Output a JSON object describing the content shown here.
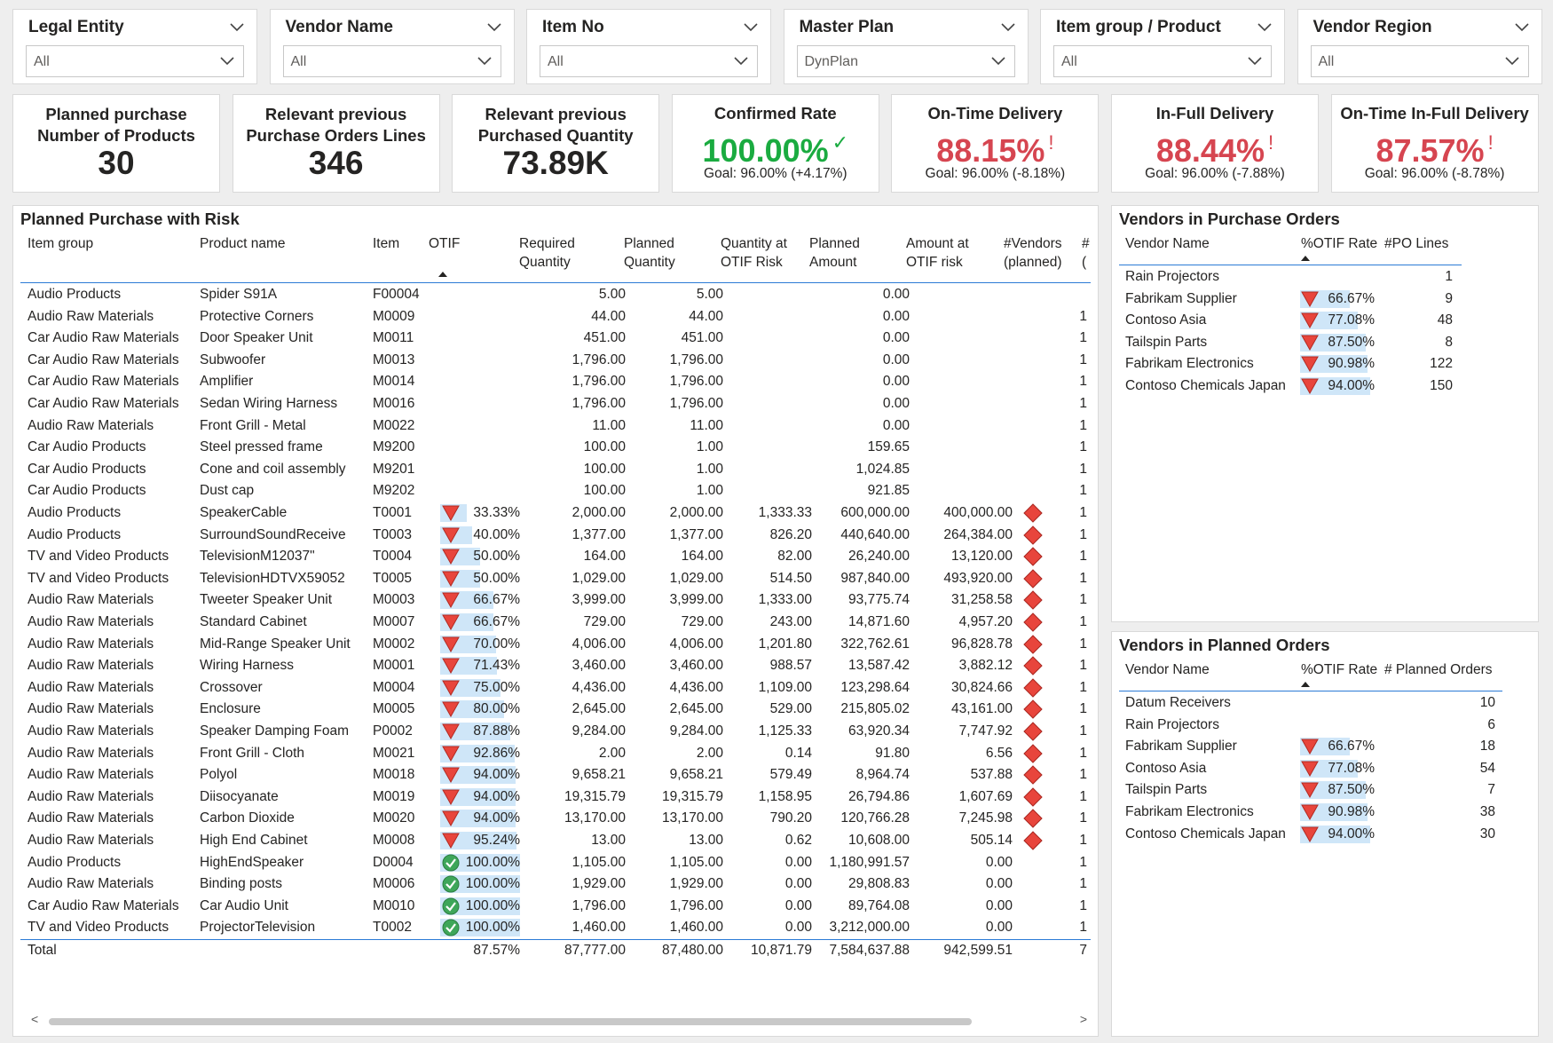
{
  "slicers": [
    {
      "title": "Legal Entity",
      "value": "All"
    },
    {
      "title": "Vendor Name",
      "value": "All"
    },
    {
      "title": "Item No",
      "value": "All"
    },
    {
      "title": "Master Plan",
      "value": "DynPlan"
    },
    {
      "title": "Item group / Product",
      "value": "All"
    },
    {
      "title": "Vendor Region",
      "value": "All"
    }
  ],
  "cards": [
    {
      "label1": "Planned purchase",
      "label2": "Number of Products",
      "value": "30"
    },
    {
      "label1": "Relevant previous",
      "label2": "Purchase Orders Lines",
      "value": "346"
    },
    {
      "label1": "Relevant previous",
      "label2": "Purchased Quantity",
      "value": "73.89K"
    }
  ],
  "kpis": [
    {
      "title": "Confirmed Rate",
      "value": "100.00%",
      "mark": "✓",
      "status": "good",
      "goal": "Goal: 96.00% (+4.17%)"
    },
    {
      "title": "On-Time Delivery",
      "value": "88.15%",
      "mark": "!",
      "status": "bad",
      "goal": "Goal: 96.00% (-8.18%)"
    },
    {
      "title": "In-Full Delivery",
      "value": "88.44%",
      "mark": "!",
      "status": "bad",
      "goal": "Goal: 96.00% (-7.88%)"
    },
    {
      "title": "On-Time In-Full Delivery",
      "value": "87.57%",
      "mark": "!",
      "status": "bad",
      "goal": "Goal: 96.00% (-8.78%)"
    }
  ],
  "colors": {
    "good": "#1aab40",
    "bad": "#d64550",
    "bar": "#cfe6f8",
    "accent": "#2b7bd6",
    "risk": "#e8453c"
  },
  "main_table": {
    "title": "Planned Purchase with Risk",
    "headers": [
      {
        "l1": "Item group",
        "l2": ""
      },
      {
        "l1": "Product name",
        "l2": ""
      },
      {
        "l1": "Item",
        "l2": ""
      },
      {
        "l1": "OTIF",
        "l2": ""
      },
      {
        "l1": "Required",
        "l2": "Quantity"
      },
      {
        "l1": "Planned",
        "l2": "Quantity"
      },
      {
        "l1": "Quantity at",
        "l2": "OTIF Risk"
      },
      {
        "l1": "Planned",
        "l2": "Amount"
      },
      {
        "l1": "Amount at",
        "l2": "OTIF risk"
      },
      {
        "l1": "#Vendors",
        "l2": "(planned)"
      },
      {
        "l1": "#",
        "l2": "("
      }
    ],
    "rows": [
      {
        "group": "Audio Products",
        "product": "Spider S91A",
        "item": "F00004",
        "otif": "",
        "otif_value": null,
        "otif_icon": "",
        "req": "5.00",
        "planned": "5.00",
        "qrisk": "",
        "amount": "0.00",
        "arisk": "",
        "risk": false,
        "vendors": ""
      },
      {
        "group": "Audio Raw Materials",
        "product": "Protective Corners",
        "item": "M0009",
        "otif": "",
        "otif_value": null,
        "otif_icon": "",
        "req": "44.00",
        "planned": "44.00",
        "qrisk": "",
        "amount": "0.00",
        "arisk": "",
        "risk": false,
        "vendors": "1"
      },
      {
        "group": "Car Audio Raw Materials",
        "product": "Door Speaker Unit",
        "item": "M0011",
        "otif": "",
        "otif_value": null,
        "otif_icon": "",
        "req": "451.00",
        "planned": "451.00",
        "qrisk": "",
        "amount": "0.00",
        "arisk": "",
        "risk": false,
        "vendors": "1"
      },
      {
        "group": "Car Audio Raw Materials",
        "product": "Subwoofer",
        "item": "M0013",
        "otif": "",
        "otif_value": null,
        "otif_icon": "",
        "req": "1,796.00",
        "planned": "1,796.00",
        "qrisk": "",
        "amount": "0.00",
        "arisk": "",
        "risk": false,
        "vendors": "1"
      },
      {
        "group": "Car Audio Raw Materials",
        "product": "Amplifier",
        "item": "M0014",
        "otif": "",
        "otif_value": null,
        "otif_icon": "",
        "req": "1,796.00",
        "planned": "1,796.00",
        "qrisk": "",
        "amount": "0.00",
        "arisk": "",
        "risk": false,
        "vendors": "1"
      },
      {
        "group": "Car Audio Raw Materials",
        "product": "Sedan Wiring Harness",
        "item": "M0016",
        "otif": "",
        "otif_value": null,
        "otif_icon": "",
        "req": "1,796.00",
        "planned": "1,796.00",
        "qrisk": "",
        "amount": "0.00",
        "arisk": "",
        "risk": false,
        "vendors": "1"
      },
      {
        "group": "Audio Raw Materials",
        "product": "Front Grill - Metal",
        "item": "M0022",
        "otif": "",
        "otif_value": null,
        "otif_icon": "",
        "req": "11.00",
        "planned": "11.00",
        "qrisk": "",
        "amount": "0.00",
        "arisk": "",
        "risk": false,
        "vendors": "1"
      },
      {
        "group": "Car Audio Products",
        "product": "Steel pressed frame",
        "item": "M9200",
        "otif": "",
        "otif_value": null,
        "otif_icon": "",
        "req": "100.00",
        "planned": "1.00",
        "qrisk": "",
        "amount": "159.65",
        "arisk": "",
        "risk": false,
        "vendors": "1"
      },
      {
        "group": "Car Audio Products",
        "product": "Cone and coil assembly",
        "item": "M9201",
        "otif": "",
        "otif_value": null,
        "otif_icon": "",
        "req": "100.00",
        "planned": "1.00",
        "qrisk": "",
        "amount": "1,024.85",
        "arisk": "",
        "risk": false,
        "vendors": "1"
      },
      {
        "group": "Car Audio Products",
        "product": "Dust cap",
        "item": "M9202",
        "otif": "",
        "otif_value": null,
        "otif_icon": "",
        "req": "100.00",
        "planned": "1.00",
        "qrisk": "",
        "amount": "921.85",
        "arisk": "",
        "risk": false,
        "vendors": "1"
      },
      {
        "group": "Audio Products",
        "product": "SpeakerCable",
        "item": "T0001",
        "otif": "33.33%",
        "otif_value": 33.33,
        "otif_icon": "down",
        "req": "2,000.00",
        "planned": "2,000.00",
        "qrisk": "1,333.33",
        "amount": "600,000.00",
        "arisk": "400,000.00",
        "risk": true,
        "vendors": "1"
      },
      {
        "group": "Audio Products",
        "product": "SurroundSoundReceive",
        "item": "T0003",
        "otif": "40.00%",
        "otif_value": 40.0,
        "otif_icon": "down",
        "req": "1,377.00",
        "planned": "1,377.00",
        "qrisk": "826.20",
        "amount": "440,640.00",
        "arisk": "264,384.00",
        "risk": true,
        "vendors": "1"
      },
      {
        "group": "TV and Video Products",
        "product": "TelevisionM12037\"",
        "item": "T0004",
        "otif": "50.00%",
        "otif_value": 50.0,
        "otif_icon": "down",
        "req": "164.00",
        "planned": "164.00",
        "qrisk": "82.00",
        "amount": "26,240.00",
        "arisk": "13,120.00",
        "risk": true,
        "vendors": "1"
      },
      {
        "group": "TV and Video Products",
        "product": "TelevisionHDTVX59052",
        "item": "T0005",
        "otif": "50.00%",
        "otif_value": 50.0,
        "otif_icon": "down",
        "req": "1,029.00",
        "planned": "1,029.00",
        "qrisk": "514.50",
        "amount": "987,840.00",
        "arisk": "493,920.00",
        "risk": true,
        "vendors": "1"
      },
      {
        "group": "Audio Raw Materials",
        "product": "Tweeter Speaker Unit",
        "item": "M0003",
        "otif": "66.67%",
        "otif_value": 66.67,
        "otif_icon": "down",
        "req": "3,999.00",
        "planned": "3,999.00",
        "qrisk": "1,333.00",
        "amount": "93,775.74",
        "arisk": "31,258.58",
        "risk": true,
        "vendors": "1"
      },
      {
        "group": "Audio Raw Materials",
        "product": "Standard Cabinet",
        "item": "M0007",
        "otif": "66.67%",
        "otif_value": 66.67,
        "otif_icon": "down",
        "req": "729.00",
        "planned": "729.00",
        "qrisk": "243.00",
        "amount": "14,871.60",
        "arisk": "4,957.20",
        "risk": true,
        "vendors": "1"
      },
      {
        "group": "Audio Raw Materials",
        "product": "Mid-Range Speaker Unit",
        "item": "M0002",
        "otif": "70.00%",
        "otif_value": 70.0,
        "otif_icon": "down",
        "req": "4,006.00",
        "planned": "4,006.00",
        "qrisk": "1,201.80",
        "amount": "322,762.61",
        "arisk": "96,828.78",
        "risk": true,
        "vendors": "1"
      },
      {
        "group": "Audio Raw Materials",
        "product": "Wiring Harness",
        "item": "M0001",
        "otif": "71.43%",
        "otif_value": 71.43,
        "otif_icon": "down",
        "req": "3,460.00",
        "planned": "3,460.00",
        "qrisk": "988.57",
        "amount": "13,587.42",
        "arisk": "3,882.12",
        "risk": true,
        "vendors": "1"
      },
      {
        "group": "Audio Raw Materials",
        "product": "Crossover",
        "item": "M0004",
        "otif": "75.00%",
        "otif_value": 75.0,
        "otif_icon": "down",
        "req": "4,436.00",
        "planned": "4,436.00",
        "qrisk": "1,109.00",
        "amount": "123,298.64",
        "arisk": "30,824.66",
        "risk": true,
        "vendors": "1"
      },
      {
        "group": "Audio Raw Materials",
        "product": "Enclosure",
        "item": "M0005",
        "otif": "80.00%",
        "otif_value": 80.0,
        "otif_icon": "down",
        "req": "2,645.00",
        "planned": "2,645.00",
        "qrisk": "529.00",
        "amount": "215,805.02",
        "arisk": "43,161.00",
        "risk": true,
        "vendors": "1"
      },
      {
        "group": "Audio Raw Materials",
        "product": "Speaker Damping Foam",
        "item": "P0002",
        "otif": "87.88%",
        "otif_value": 87.88,
        "otif_icon": "down",
        "req": "9,284.00",
        "planned": "9,284.00",
        "qrisk": "1,125.33",
        "amount": "63,920.34",
        "arisk": "7,747.92",
        "risk": true,
        "vendors": "1"
      },
      {
        "group": "Audio Raw Materials",
        "product": "Front Grill - Cloth",
        "item": "M0021",
        "otif": "92.86%",
        "otif_value": 92.86,
        "otif_icon": "down",
        "req": "2.00",
        "planned": "2.00",
        "qrisk": "0.14",
        "amount": "91.80",
        "arisk": "6.56",
        "risk": true,
        "vendors": "1"
      },
      {
        "group": "Audio Raw Materials",
        "product": "Polyol",
        "item": "M0018",
        "otif": "94.00%",
        "otif_value": 94.0,
        "otif_icon": "down",
        "req": "9,658.21",
        "planned": "9,658.21",
        "qrisk": "579.49",
        "amount": "8,964.74",
        "arisk": "537.88",
        "risk": true,
        "vendors": "1"
      },
      {
        "group": "Audio Raw Materials",
        "product": "Diisocyanate",
        "item": "M0019",
        "otif": "94.00%",
        "otif_value": 94.0,
        "otif_icon": "down",
        "req": "19,315.79",
        "planned": "19,315.79",
        "qrisk": "1,158.95",
        "amount": "26,794.86",
        "arisk": "1,607.69",
        "risk": true,
        "vendors": "1"
      },
      {
        "group": "Audio Raw Materials",
        "product": "Carbon Dioxide",
        "item": "M0020",
        "otif": "94.00%",
        "otif_value": 94.0,
        "otif_icon": "down",
        "req": "13,170.00",
        "planned": "13,170.00",
        "qrisk": "790.20",
        "amount": "120,766.28",
        "arisk": "7,245.98",
        "risk": true,
        "vendors": "1"
      },
      {
        "group": "Audio Raw Materials",
        "product": "High End Cabinet",
        "item": "M0008",
        "otif": "95.24%",
        "otif_value": 95.24,
        "otif_icon": "down",
        "req": "13.00",
        "planned": "13.00",
        "qrisk": "0.62",
        "amount": "10,608.00",
        "arisk": "505.14",
        "risk": true,
        "vendors": "1"
      },
      {
        "group": "Audio Products",
        "product": "HighEndSpeaker",
        "item": "D0004",
        "otif": "100.00%",
        "otif_value": 100.0,
        "otif_icon": "check",
        "req": "1,105.00",
        "planned": "1,105.00",
        "qrisk": "0.00",
        "amount": "1,180,991.57",
        "arisk": "0.00",
        "risk": false,
        "vendors": "1"
      },
      {
        "group": "Audio Raw Materials",
        "product": "Binding posts",
        "item": "M0006",
        "otif": "100.00%",
        "otif_value": 100.0,
        "otif_icon": "check",
        "req": "1,929.00",
        "planned": "1,929.00",
        "qrisk": "0.00",
        "amount": "29,808.83",
        "arisk": "0.00",
        "risk": false,
        "vendors": "1"
      },
      {
        "group": "Car Audio Raw Materials",
        "product": "Car Audio Unit",
        "item": "M0010",
        "otif": "100.00%",
        "otif_value": 100.0,
        "otif_icon": "check",
        "req": "1,796.00",
        "planned": "1,796.00",
        "qrisk": "0.00",
        "amount": "89,764.08",
        "arisk": "0.00",
        "risk": false,
        "vendors": "1"
      },
      {
        "group": "TV and Video Products",
        "product": "ProjectorTelevision",
        "item": "T0002",
        "otif": "100.00%",
        "otif_value": 100.0,
        "otif_icon": "check",
        "req": "1,460.00",
        "planned": "1,460.00",
        "qrisk": "0.00",
        "amount": "3,212,000.00",
        "arisk": "0.00",
        "risk": false,
        "vendors": "1"
      }
    ],
    "total": {
      "label": "Total",
      "otif": "87.57%",
      "req": "87,777.00",
      "planned": "87,480.00",
      "qrisk": "10,871.79",
      "amount": "7,584,637.88",
      "arisk": "942,599.51",
      "vendors": "7"
    },
    "scroll": {
      "left": "<",
      "right": ">"
    }
  },
  "po_table": {
    "title": "Vendors in Purchase Orders",
    "headers": [
      "Vendor Name",
      "%OTIF Rate",
      "#PO Lines"
    ],
    "rows": [
      {
        "name": "Rain Projectors",
        "rate": "",
        "rate_value": null,
        "count": "1"
      },
      {
        "name": "Fabrikam Supplier",
        "rate": "66.67%",
        "rate_value": 66.67,
        "count": "9"
      },
      {
        "name": "Contoso Asia",
        "rate": "77.08%",
        "rate_value": 77.08,
        "count": "48"
      },
      {
        "name": "Tailspin Parts",
        "rate": "87.50%",
        "rate_value": 87.5,
        "count": "8"
      },
      {
        "name": "Fabrikam Electronics",
        "rate": "90.98%",
        "rate_value": 90.98,
        "count": "122"
      },
      {
        "name": "Contoso Chemicals Japan",
        "rate": "94.00%",
        "rate_value": 94.0,
        "count": "150"
      }
    ]
  },
  "planned_table": {
    "title": "Vendors in Planned Orders",
    "headers": [
      "Vendor Name",
      "%OTIF Rate",
      "# Planned Orders"
    ],
    "rows": [
      {
        "name": "Datum Receivers",
        "rate": "",
        "rate_value": null,
        "count": "10"
      },
      {
        "name": "Rain Projectors",
        "rate": "",
        "rate_value": null,
        "count": "6"
      },
      {
        "name": "Fabrikam Supplier",
        "rate": "66.67%",
        "rate_value": 66.67,
        "count": "18"
      },
      {
        "name": "Contoso Asia",
        "rate": "77.08%",
        "rate_value": 77.08,
        "count": "54"
      },
      {
        "name": "Tailspin Parts",
        "rate": "87.50%",
        "rate_value": 87.5,
        "count": "7"
      },
      {
        "name": "Fabrikam Electronics",
        "rate": "90.98%",
        "rate_value": 90.98,
        "count": "38"
      },
      {
        "name": "Contoso Chemicals Japan",
        "rate": "94.00%",
        "rate_value": 94.0,
        "count": "30"
      }
    ]
  }
}
